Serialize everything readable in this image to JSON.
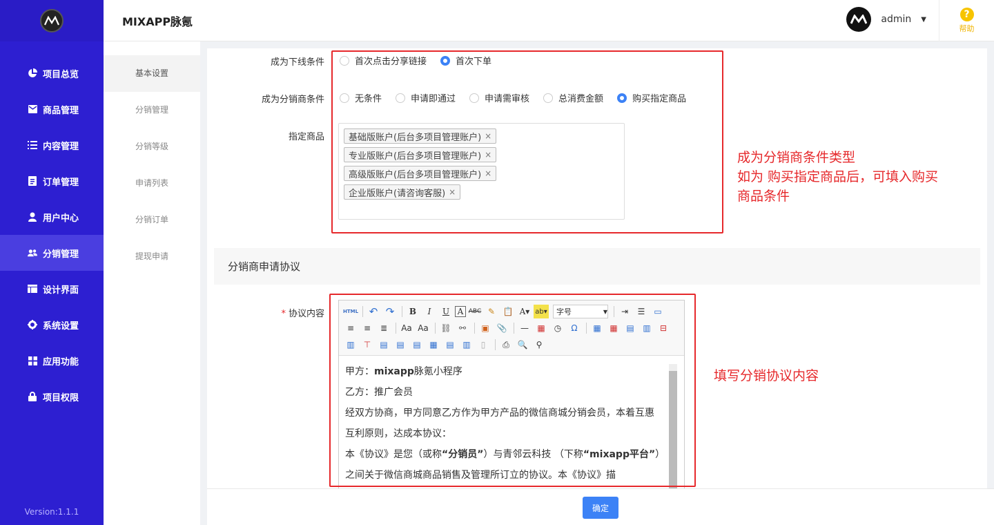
{
  "app": {
    "title": "MIXAPP脉氪",
    "version": "Version:1.1.1"
  },
  "header": {
    "user": "admin",
    "help": "帮助"
  },
  "sidebar": {
    "items": [
      {
        "label": "项目总览",
        "icon": "pie-chart-icon"
      },
      {
        "label": "商品管理",
        "icon": "mail-icon"
      },
      {
        "label": "内容管理",
        "icon": "list-icon"
      },
      {
        "label": "订单管理",
        "icon": "document-icon"
      },
      {
        "label": "用户中心",
        "icon": "user-icon"
      },
      {
        "label": "分销管理",
        "icon": "users-icon"
      },
      {
        "label": "设计界面",
        "icon": "layout-icon"
      },
      {
        "label": "系统设置",
        "icon": "gear-icon"
      },
      {
        "label": "应用功能",
        "icon": "grid-icon"
      },
      {
        "label": "项目权限",
        "icon": "lock-icon"
      }
    ],
    "active": "分销管理"
  },
  "submenu": {
    "items": [
      "基本设置",
      "分销管理",
      "分销等级",
      "申请列表",
      "分销订单",
      "提现申请"
    ],
    "active": "基本设置"
  },
  "form": {
    "downline_label": "成为下线条件",
    "downline_options": [
      {
        "label": "首次点击分享链接",
        "checked": false
      },
      {
        "label": "首次下单",
        "checked": true
      }
    ],
    "distributor_label": "成为分销商条件",
    "distributor_options": [
      {
        "label": "无条件",
        "checked": false
      },
      {
        "label": "申请即通过",
        "checked": false
      },
      {
        "label": "申请需审核",
        "checked": false
      },
      {
        "label": "总消费金额",
        "checked": false
      },
      {
        "label": "购买指定商品",
        "checked": true
      }
    ],
    "products_label": "指定商品",
    "products": [
      "基础版账户(后台多项目管理账户)",
      "专业版账户(后台多项目管理账户)",
      "高级版账户(后台多项目管理账户)",
      "企业版账户(请咨询客服)"
    ],
    "agreement_section": "分销商申请协议",
    "agreement_label": "协议内容",
    "required_mark": "*",
    "font_size_select": "字号",
    "confirm_button": "确定"
  },
  "agreement_text": {
    "line1_prefix": "甲方：",
    "line1_bold": "mixapp",
    "line1_suffix": "脉氪小程序",
    "line2": "乙方：推广会员",
    "line3": "经双方协商，甲方同意乙方作为甲方产品的微信商城分销会员，本着互惠互利原则，达成本协议：",
    "line4_a": "本《协议》是您（或称",
    "line4_b": "“分销员”",
    "line4_c": "）与青邻云科技 （下称",
    "line4_d": "“mixapp平台”",
    "line4_e": "）之间关于微信商城商品销售及管理所订立的协议。本《协议》描"
  },
  "annotations": {
    "condition_note_1": "成为分销商条件类型",
    "condition_note_2": "如为 购买指定商品后，可填入购买",
    "condition_note_3": "商品条件",
    "agreement_note": "填写分销协议内容"
  },
  "colors": {
    "sidebar": "#2d1fd1",
    "accent": "#3c82f6",
    "annotation": "#e6282b"
  }
}
